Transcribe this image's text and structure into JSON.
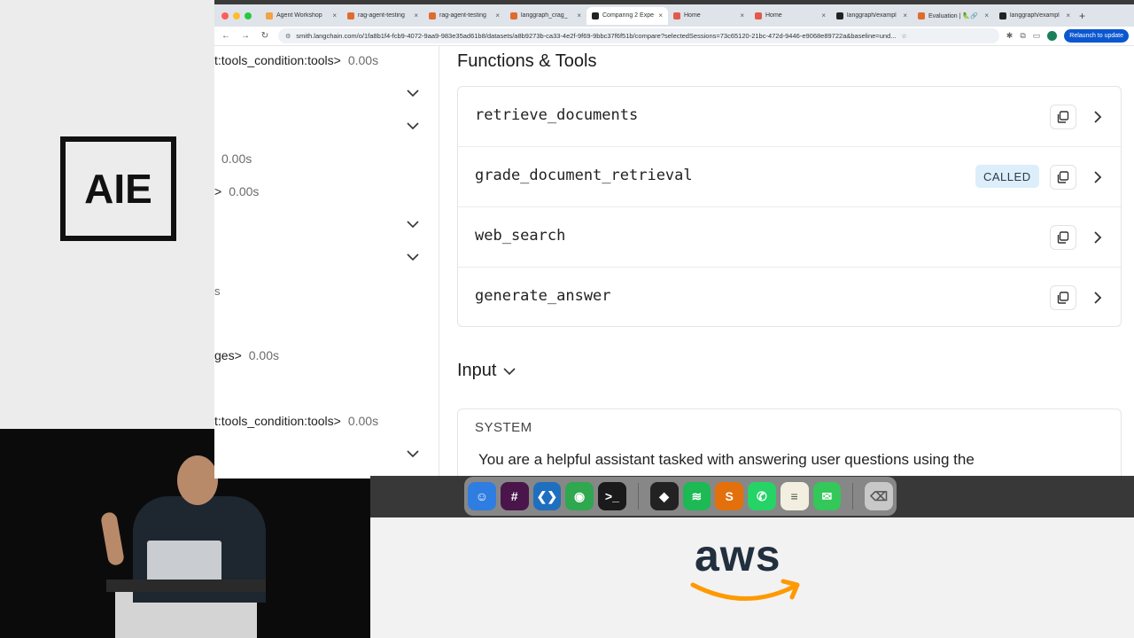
{
  "branding": {
    "logo_text": "AIE",
    "sponsor_logo_text": "aws"
  },
  "browser": {
    "tabs": [
      {
        "label": "Agent Workshop",
        "color": "#f4a340",
        "active": false
      },
      {
        "label": "rag-agent-testing",
        "color": "#e06b2d",
        "active": false
      },
      {
        "label": "rag-agent-testing",
        "color": "#e06b2d",
        "active": false
      },
      {
        "label": "langgraph_crag_",
        "color": "#e06b2d",
        "active": false
      },
      {
        "label": "Comparing 2 Expe",
        "color": "#222222",
        "active": true
      },
      {
        "label": "Home",
        "color": "#e05a4a",
        "active": false
      },
      {
        "label": "Home",
        "color": "#e05a4a",
        "active": false
      },
      {
        "label": "langgraph/exampl",
        "color": "#222222",
        "active": false
      },
      {
        "label": "Evaluation | 🦜🔗",
        "color": "#e06b2d",
        "active": false
      },
      {
        "label": "langgraph/exampl",
        "color": "#222222",
        "active": false
      }
    ],
    "new_tab_glyph": "+",
    "url": "smith.langchain.com/o/1fa8b1f4-fcb9-4072-9aa9-983e35ad61b8/datasets/a8b9273b-ca33-4e2f-9f69-9bbc37f6f51b/compare?selectedSessions=73c65120-21bc-472d-9446-e9068e89722a&baseline=und...",
    "relaunch_label": "Relaunch to update"
  },
  "left_pane": {
    "rows": [
      {
        "label": "t:tools_condition:tools>",
        "duration": "0.00s"
      },
      {
        "label": "",
        "duration": "0.00s"
      },
      {
        "label": ">",
        "duration": "0.00s"
      },
      {
        "label": "s",
        "duration": ""
      },
      {
        "label": "ges>",
        "duration": "0.00s"
      },
      {
        "label": "t:tools_condition:tools>",
        "duration": "0.00s"
      }
    ]
  },
  "functions_tools": {
    "heading": "Functions & Tools",
    "tools": [
      {
        "name": "retrieve_documents",
        "badge": ""
      },
      {
        "name": "grade_document_retrieval",
        "badge": "CALLED"
      },
      {
        "name": "web_search",
        "badge": ""
      },
      {
        "name": "generate_answer",
        "badge": ""
      }
    ]
  },
  "input_section": {
    "heading": "Input",
    "message_role": "SYSTEM",
    "message_text": "You are a helpful assistant tasked with answering user questions using the"
  },
  "dock": {
    "apps": [
      {
        "name": "finder",
        "glyph": "☺",
        "color": "#2f7de1"
      },
      {
        "name": "slack",
        "glyph": "#",
        "color": "#4a154b"
      },
      {
        "name": "vscode",
        "glyph": "❮❯",
        "color": "#1f6fbf"
      },
      {
        "name": "chrome",
        "glyph": "◉",
        "color": "#2fa84f"
      },
      {
        "name": "terminal",
        "glyph": ">_",
        "color": "#1a1a1a"
      },
      {
        "name": "cursor",
        "glyph": "◆",
        "color": "#222222"
      },
      {
        "name": "spotify",
        "glyph": "≋",
        "color": "#1db954"
      },
      {
        "name": "sublime",
        "glyph": "S",
        "color": "#e3700b"
      },
      {
        "name": "whatsapp",
        "glyph": "✆",
        "color": "#25d366"
      },
      {
        "name": "notes",
        "glyph": "≡",
        "color": "#f3efe0"
      },
      {
        "name": "messages",
        "glyph": "✉",
        "color": "#34c759"
      },
      {
        "name": "trash",
        "glyph": "⌫",
        "color": "#c8c8c8"
      }
    ]
  },
  "colors": {
    "accent_blue": "#0b57d0",
    "called_badge_bg": "#dbeefa",
    "aws_orange": "#ff9900"
  }
}
